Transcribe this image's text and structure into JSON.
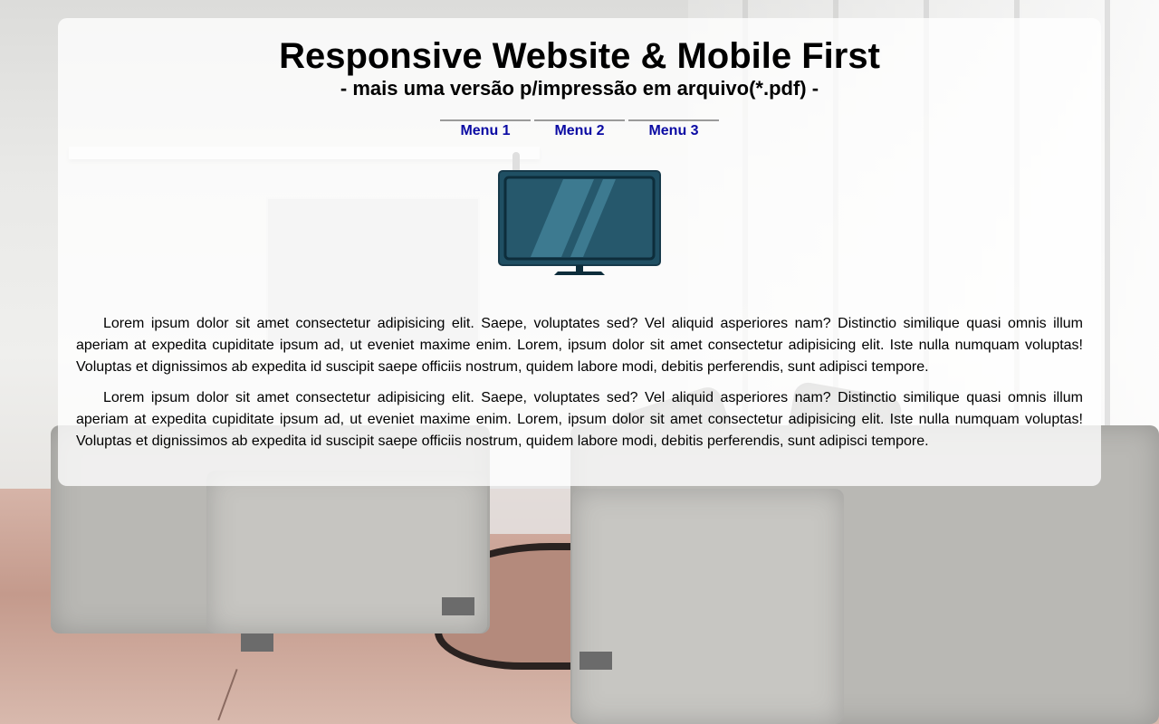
{
  "header": {
    "title": "Responsive Website & Mobile First",
    "subtitle": "- mais uma versão p/impressão em arquivo(*.pdf) -"
  },
  "nav": {
    "items": [
      {
        "label": "Menu 1"
      },
      {
        "label": "Menu 2"
      },
      {
        "label": "Menu 3"
      }
    ]
  },
  "main": {
    "icon": "tv-monitor-icon",
    "paragraphs": [
      "Lorem ipsum dolor sit amet consectetur adipisicing elit. Saepe, voluptates sed? Vel aliquid asperiores nam? Distinctio similique quasi omnis illum aperiam at expedita cupiditate ipsum ad, ut eveniet maxime enim. Lorem, ipsum dolor sit amet consectetur adipisicing elit. Iste nulla numquam voluptas! Voluptas et dignissimos ab expedita id suscipit saepe officiis nostrum, quidem labore modi, debitis perferendis, sunt adipisci tempore.",
      "Lorem ipsum dolor sit amet consectetur adipisicing elit. Saepe, voluptates sed? Vel aliquid asperiores nam? Distinctio similique quasi omnis illum aperiam at expedita cupiditate ipsum ad, ut eveniet maxime enim. Lorem, ipsum dolor sit amet consectetur adipisicing elit. Iste nulla numquam voluptas! Voluptas et dignissimos ab expedita id suscipit saepe officiis nostrum, quidem labore modi, debitis perferendis, sunt adipisci tempore."
    ]
  },
  "colors": {
    "link": "#0a0aa3",
    "tv_body": "#1f4f63",
    "tv_screen": "#26586c",
    "tv_frame": "#0d2d3b"
  }
}
